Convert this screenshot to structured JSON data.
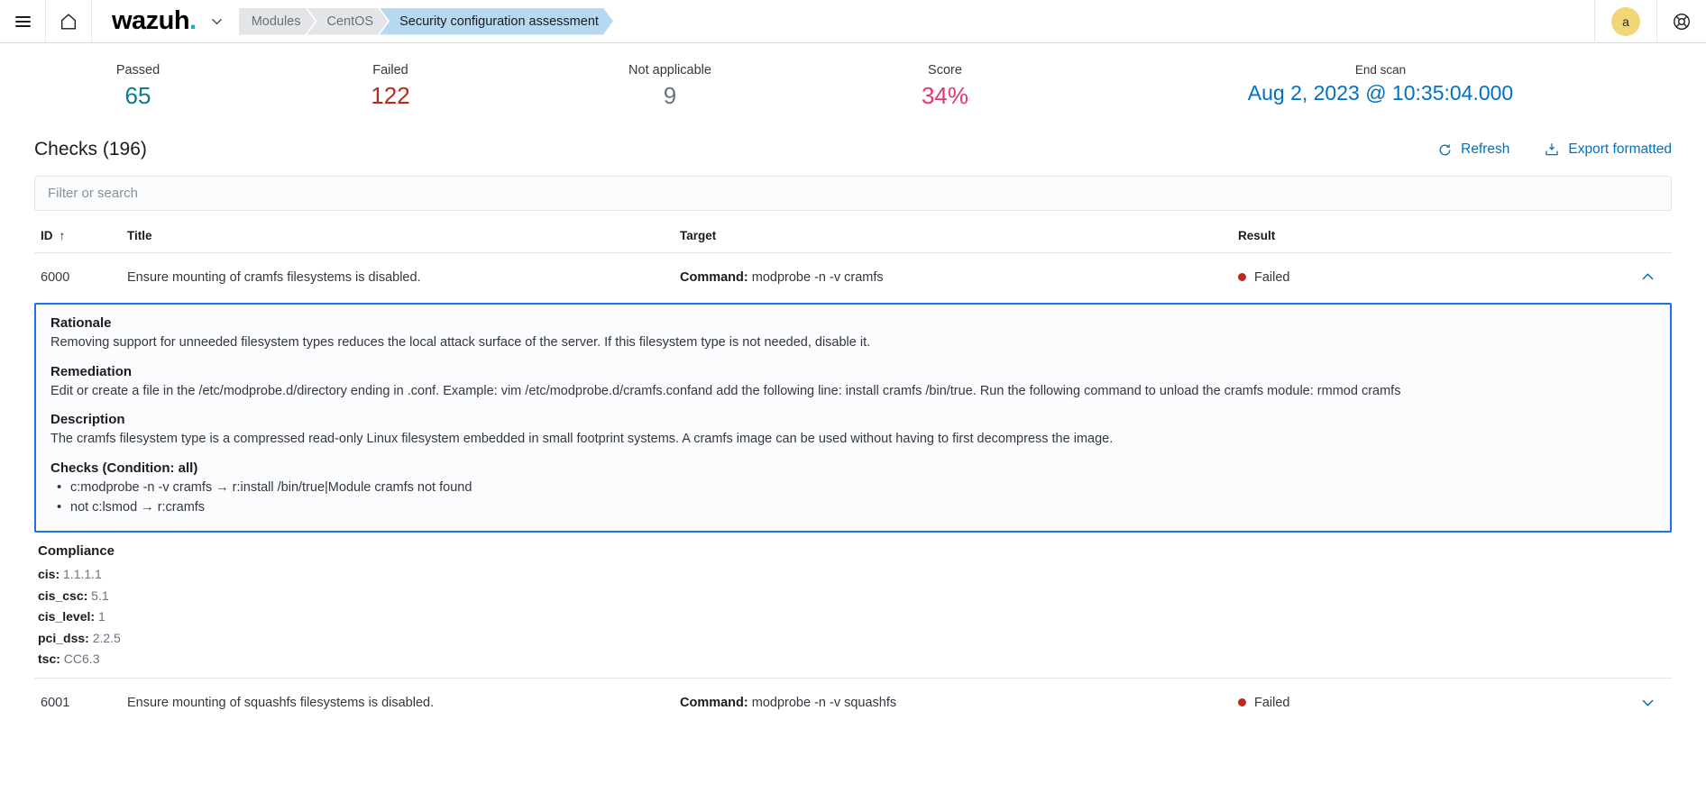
{
  "topnav": {
    "menu_icon": "hamburger-menu-icon",
    "home_icon": "home-icon",
    "logo_text": "wazuh",
    "logo_dot": ".",
    "logo_chevron": "chevron-down-icon",
    "breadcrumbs": [
      {
        "label": "Modules",
        "active": false
      },
      {
        "label": "CentOS",
        "active": false
      },
      {
        "label": "Security configuration assessment",
        "active": true
      }
    ],
    "avatar_initial": "a",
    "help_icon": "lifebuoy-help-icon"
  },
  "stats": [
    {
      "label": "Passed",
      "value": "65",
      "color": "#0a7c8c"
    },
    {
      "label": "Failed",
      "value": "122",
      "color": "#bd271e"
    },
    {
      "label": "Not applicable",
      "value": "9",
      "color": "#6b7280"
    },
    {
      "label": "Score",
      "value": "34%",
      "color": "#e7336e"
    },
    {
      "label": "End scan",
      "value": "Aug 2, 2023 @ 10:35:04.000",
      "color": "#0071c2"
    }
  ],
  "checks_section": {
    "title": "Checks (196)",
    "refresh_label": "Refresh",
    "refresh_icon": "refresh-icon",
    "export_label": "Export formatted",
    "export_icon": "export-download-icon"
  },
  "search": {
    "placeholder": "Filter or search",
    "value": ""
  },
  "table": {
    "columns": [
      {
        "label": "ID",
        "sort": "↑"
      },
      {
        "label": "Title",
        "sort": ""
      },
      {
        "label": "Target",
        "sort": ""
      },
      {
        "label": "Result",
        "sort": ""
      }
    ],
    "rows": [
      {
        "id": "6000",
        "title": "Ensure mounting of cramfs filesystems is disabled.",
        "target_label": "Command:",
        "target_value": " modprobe -n -v cramfs",
        "result": "Failed",
        "expanded": true,
        "chevron": "chevron-up-icon"
      },
      {
        "id": "6001",
        "title": "Ensure mounting of squashfs filesystems is disabled.",
        "target_label": "Command:",
        "target_value": " modprobe -n -v squashfs",
        "result": "Failed",
        "expanded": false,
        "chevron": "chevron-down-icon"
      }
    ]
  },
  "detail": {
    "rationale_head": "Rationale",
    "rationale_text": "Removing support for unneeded filesystem types reduces the local attack surface of the server. If this filesystem type is not needed, disable it.",
    "remediation_head": "Remediation",
    "remediation_text": "Edit or create a file in the /etc/modprobe.d/directory ending in .conf. Example: vim /etc/modprobe.d/cramfs.confand add the following line: install cramfs /bin/true. Run the following command to unload the cramfs module: rmmod cramfs",
    "description_head": "Description",
    "description_text": "The cramfs filesystem type is a compressed read-only Linux filesystem embedded in small footprint systems. A cramfs image can be used without having to first decompress the image.",
    "checks_head": "Checks (Condition: all)",
    "checks_items": [
      "c:modprobe -n -v cramfs → r:install /bin/true|Module cramfs not found",
      "not c:lsmod → r:cramfs"
    ]
  },
  "compliance": {
    "head": "Compliance",
    "items": [
      {
        "key": "cis:",
        "value": "1.1.1.1"
      },
      {
        "key": "cis_csc:",
        "value": "5.1"
      },
      {
        "key": "cis_level:",
        "value": "1"
      },
      {
        "key": "pci_dss:",
        "value": "2.2.5"
      },
      {
        "key": "tsc:",
        "value": "CC6.3"
      }
    ]
  }
}
